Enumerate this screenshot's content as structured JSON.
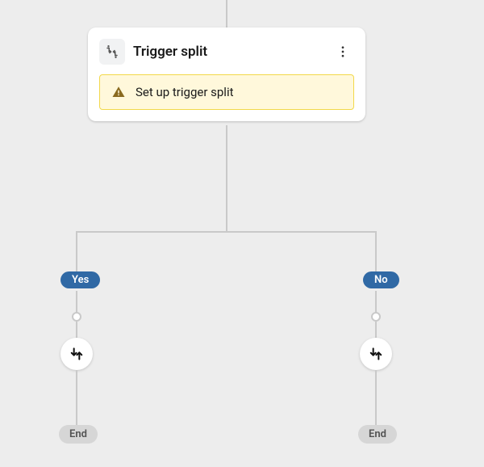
{
  "card": {
    "title": "Trigger split",
    "alert_text": "Set up trigger split"
  },
  "branches": {
    "left": {
      "label": "Yes",
      "end_label": "End"
    },
    "right": {
      "label": "No",
      "end_label": "End"
    }
  }
}
